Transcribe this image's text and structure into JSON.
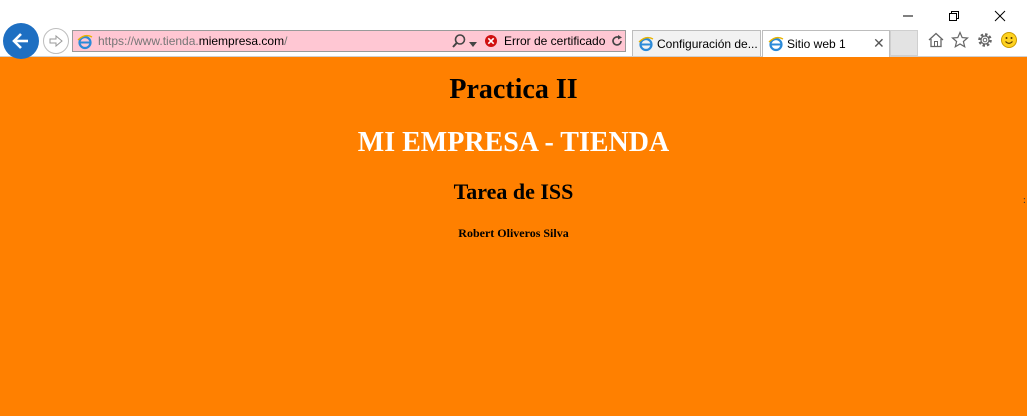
{
  "browser": {
    "address": {
      "url_prefix": "https://www.tienda.",
      "url_domain": "miempresa.com",
      "url_suffix": "/",
      "cert_error": "Error de certificado"
    },
    "tabs": [
      {
        "label": "Configuración de..."
      },
      {
        "label": "Sitio web 1",
        "active": true
      }
    ],
    "window_controls": [
      "minimize-icon",
      "restore-icon",
      "close-icon"
    ],
    "toolbar_icons": [
      "home-icon",
      "favorites-star-icon",
      "settings-gear-icon",
      "smiley-feedback-icon"
    ],
    "colors": {
      "address_error_bg": "#ffc7d3",
      "back_button": "#1e6fc2"
    }
  },
  "page": {
    "title": "Practica II",
    "company": "MI EMPRESA - TIENDA",
    "subtitle": "Tarea de ISS",
    "author": "Robert Oliveros Silva",
    "colors": {
      "background": "#ff8000",
      "company_text": "#ffffff"
    }
  }
}
